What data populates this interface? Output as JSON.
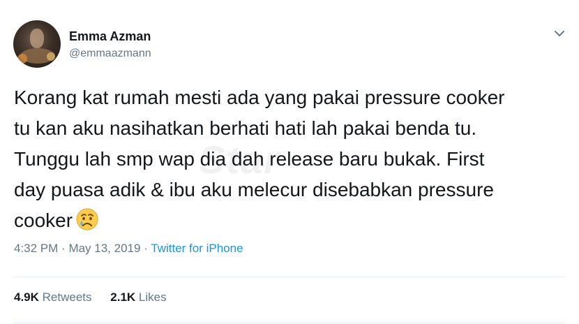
{
  "tweet": {
    "display_name": "Emma Azman",
    "handle": "@emmaazmann",
    "text": "Korang kat rumah mesti ada yang pakai pressure cooker\ntu kan aku nasihatkan berhati hati lah pakai benda tu.\nTunggu lah smp wap dia dah release baru bukak. First\nday puasa adik & ibu aku melecur disebabkan pressure\ncooker",
    "emoji": "crying-face",
    "time": "4:32 PM",
    "date": "May 13, 2019",
    "source": "Twitter for iPhone",
    "retweets_count": "4.9K",
    "retweets_label": "Retweets",
    "likes_count": "2.1K",
    "likes_label": "Likes"
  },
  "watermark": "Star",
  "colors": {
    "link": "#1b95e0",
    "muted": "#657786",
    "text": "#14171a",
    "divider": "#e6ecf0"
  }
}
